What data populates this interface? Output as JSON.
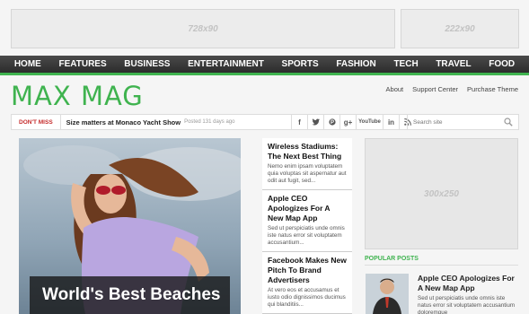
{
  "ads": {
    "leaderboard": "728x90",
    "small": "222x90",
    "sidebar": "300x250"
  },
  "nav": {
    "items": [
      "HOME",
      "FEATURES",
      "BUSINESS",
      "ENTERTAINMENT",
      "SPORTS",
      "FASHION",
      "TECH",
      "TRAVEL",
      "FOOD"
    ]
  },
  "logo": "MAX MAG",
  "top_links": [
    "About",
    "Support Center",
    "Purchase Theme"
  ],
  "ticker": {
    "label": "DON'T MISS",
    "title": "Size matters at Monaco Yacht Show",
    "time": "Posted 131 days ago"
  },
  "social": {
    "facebook": "f",
    "twitter": "t",
    "pinterest": "p",
    "google": "g+",
    "youtube": "YouTube",
    "linkedin": "in",
    "rss": "rss"
  },
  "search": {
    "placeholder": "Search site"
  },
  "feature": {
    "caption": "World's Best Beaches"
  },
  "stories": [
    {
      "title": "Wireless Stadiums: The Next Best Thing",
      "text": "Nemo enim ipsam voluptatem quia voluptas sit aspernatur aut odit aut fugit, sed..."
    },
    {
      "title": "Apple CEO Apologizes For A New Map App",
      "text": "Sed ut perspiciatis unde omnis iste natus error sit voluptatem accusantium..."
    },
    {
      "title": "Facebook Makes New Pitch To Brand Advertisers",
      "text": "At vero eos et accusamus et iusto odio dignissimos ducimus qui blanditiis..."
    }
  ],
  "popular": {
    "heading": "POPULAR POSTS",
    "item": {
      "title": "Apple CEO Apologizes For A New Map App",
      "text": "Sed ut perspiciatis unde omnis iste natus error sit voluptatem accusantium doloremque"
    }
  },
  "colors": {
    "accent": "#3fb34f",
    "nav_bg": "#333333",
    "dont_miss": "#c52c2c"
  }
}
